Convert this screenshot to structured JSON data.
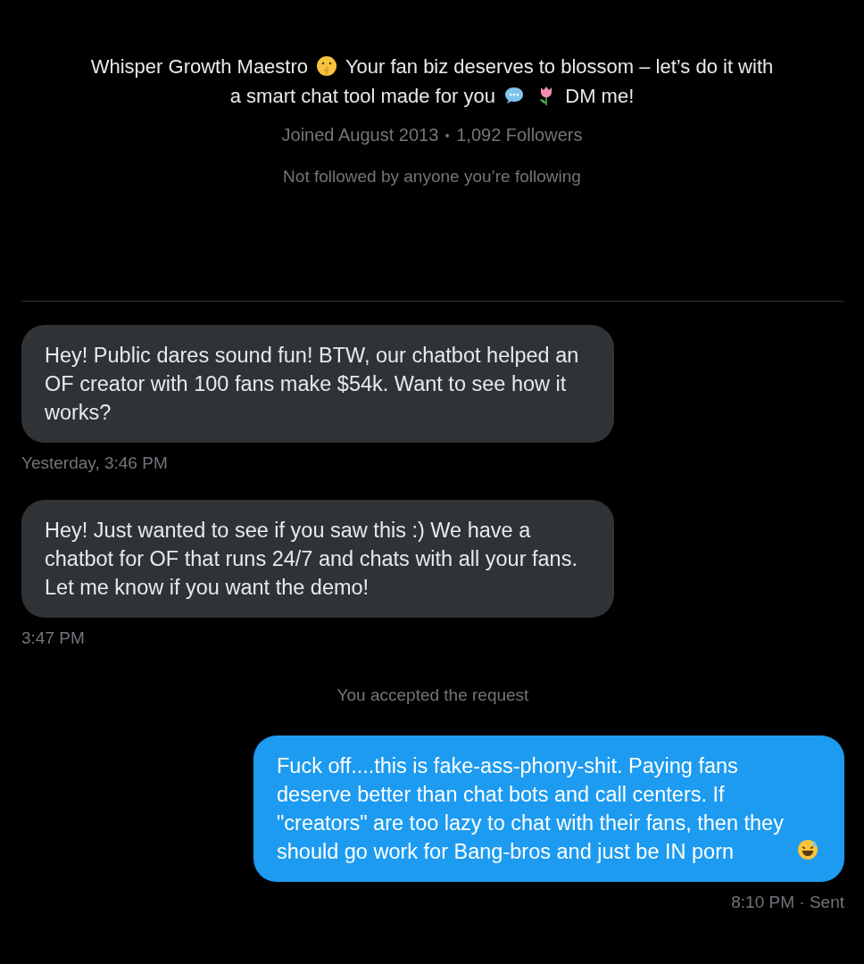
{
  "profile": {
    "bio": [
      "Whisper Growth Maestro",
      "Your fan biz deserves to blossom – let’s do it with",
      "a smart chat tool made for you",
      "DM me!"
    ],
    "joined": "Joined August 2013",
    "followers": "1,092 Followers",
    "followed_by": "Not followed by anyone you’re following"
  },
  "messages": [
    {
      "kind": "received",
      "text": "Hey! Public dares sound fun! BTW, our chatbot helped an OF creator with 100 fans make $54k. Want to see how it works?",
      "time": "Yesterday, 3:46 PM"
    },
    {
      "kind": "received",
      "text": "Hey! Just wanted to see if you saw this :) We have a chatbot for OF that runs 24/7 and chats with all your fans. Let me know if you want the demo!",
      "time": "3:47 PM"
    },
    {
      "kind": "notice",
      "text": "You accepted the request"
    },
    {
      "kind": "sent",
      "text": "Fuck off....this is fake-ass-phony-shit. Paying fans deserve better than chat bots and call centers. If \"creators\" are too lazy to chat with their fans, then they should go work for Bang-bros and just be IN porn",
      "time": "8:10 PM · Sent"
    }
  ]
}
